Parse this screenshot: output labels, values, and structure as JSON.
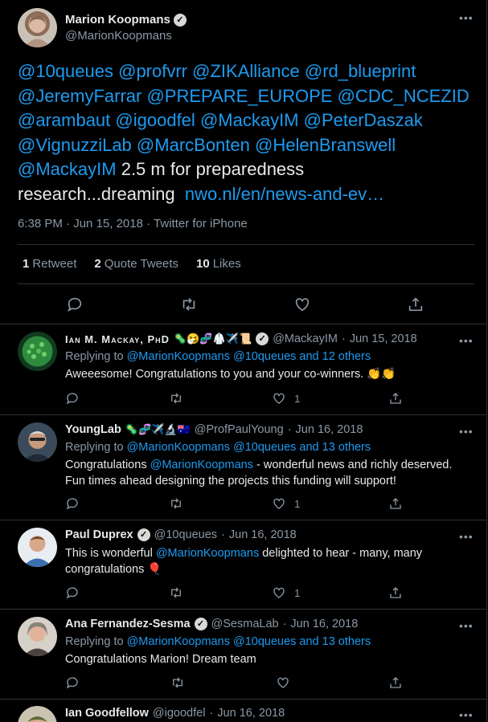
{
  "main_tweet": {
    "author_name": "Marion Koopmans",
    "author_handle": "@MarionKoopmans",
    "mentions": [
      "@10queues",
      "@profvrr",
      "@ZIKAlliance",
      "@rd_blueprint",
      "@JeremyFarrar",
      "@PREPARE_EUROPE",
      "@CDC_NCEZID",
      "@arambaut",
      "@igoodfel",
      "@MackayIM",
      "@PeterDaszak",
      "@VignuzziLab",
      "@MarcBonten",
      "@HelenBranswell",
      "@MackayIM"
    ],
    "text_part1": "2.5 m for preparedness",
    "text_part2": "research...dreaming",
    "link": "nwo.nl/en/news-and-ev…",
    "time": "6:38 PM",
    "date": "Jun 15, 2018",
    "source": "Twitter for iPhone",
    "retweets_count": "1",
    "retweets_label": "Retweet",
    "quotes_count": "2",
    "quotes_label": "Quote Tweets",
    "likes_count": "10",
    "likes_label": "Likes",
    "more_icon": "ellipsis-icon"
  },
  "replies": [
    {
      "name": "Ian M. Mackay, PhD",
      "emojis": "🦠🤧🧬🥼✈️📜",
      "verified": true,
      "handle": "@MackayIM",
      "date": "Jun 15, 2018",
      "replying_prefix": "Replying to",
      "replying_users": "@MarionKoopmans @10queues",
      "replying_others": "and 12 others",
      "text": "Aweeesome! Congratulations to you and your co-winners. 👏👏",
      "like_count": "1"
    },
    {
      "name": "YoungLab",
      "emojis": "🦠🧬✈️🔬🇦🇺",
      "verified": false,
      "handle": "@ProfPaulYoung",
      "date": "Jun 16, 2018",
      "replying_prefix": "Replying to",
      "replying_users": "@MarionKoopmans @10queues",
      "replying_others": "and 13 others",
      "text_pre": "Congratulations ",
      "text_mention": "@MarionKoopmans",
      "text_post": " - wonderful news and richly deserved.",
      "text_line2": "Fun times ahead designing the projects this funding will support!",
      "like_count": "1"
    },
    {
      "name": "Paul Duprex",
      "verified": true,
      "handle": "@10queues",
      "date": "Jun 16, 2018",
      "text_pre": "This is wonderful ",
      "text_mention": "@MarionKoopmans",
      "text_post": " delighted to hear - many, many",
      "text_line2": "congratulations 🎈",
      "like_count": "1"
    },
    {
      "name": "Ana Fernandez-Sesma",
      "verified": true,
      "handle": "@SesmaLab",
      "date": "Jun 16, 2018",
      "replying_prefix": "Replying to",
      "replying_users": "@MarionKoopmans @10queues",
      "replying_others": "and 13 others",
      "text": "Congratulations Marion! Dream team",
      "like_count": ""
    },
    {
      "name": "Ian Goodfellow",
      "handle": "@igoodfel",
      "date": "Jun 16, 2018"
    }
  ],
  "dot_separator": "·",
  "colors": {
    "background": "#000000",
    "link": "#1d9bf0",
    "muted": "#8b98a5",
    "text": "#e7e9ea",
    "divider": "#2f3336"
  }
}
